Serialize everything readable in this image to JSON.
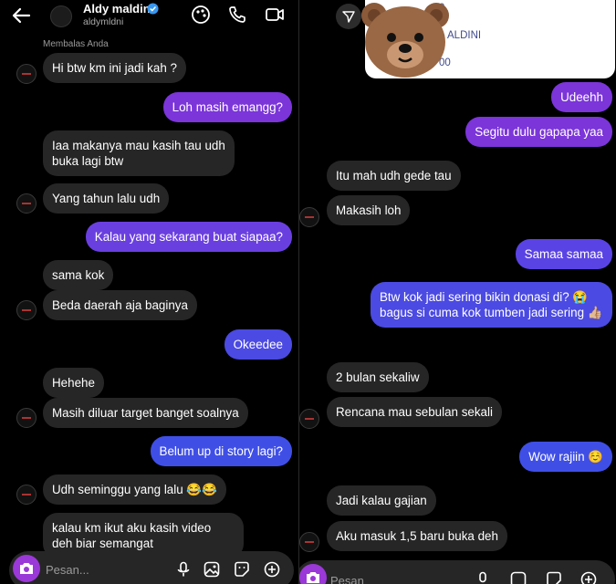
{
  "left_panel": {
    "header": {
      "name": "Aldy maldini",
      "username": "aldymldni"
    },
    "reply_note": "Membalas Anda",
    "messages": [
      {
        "text": "Hi btw km ini jadi kah ?",
        "from": "them"
      },
      {
        "text": "Loh masih emangg?",
        "from": "me"
      },
      {
        "text": "Iaa makanya mau kasih tau udh buka lagi btw",
        "from": "them"
      },
      {
        "text": "Yang tahun lalu udh",
        "from": "them"
      },
      {
        "text": "Kalau yang sekarang buat siapaa?",
        "from": "me"
      },
      {
        "text": "sama kok",
        "from": "them"
      },
      {
        "text": "Beda daerah aja baginya",
        "from": "them"
      },
      {
        "text": "Okeedee",
        "from": "me"
      },
      {
        "text": "Hehehe",
        "from": "them"
      },
      {
        "text": "Masih diluar target banget soalnya",
        "from": "them"
      },
      {
        "text": "Belum up di story lagi?",
        "from": "me"
      },
      {
        "text": "Udh seminggu yang lalu 😂😂",
        "from": "them"
      },
      {
        "text": "kalau km ikut aku kasih video deh biar semangat",
        "from": "them"
      }
    ],
    "composer": {
      "placeholder": "Pesan..."
    }
  },
  "right_panel": {
    "shared_card": {
      "line1": "0",
      "line2": "ALDINI",
      "line3": "00"
    },
    "messages": [
      {
        "text": "Udeehh",
        "from": "me"
      },
      {
        "text": "Segitu dulu gapapa yaa",
        "from": "me"
      },
      {
        "text": "Itu mah udh gede tau",
        "from": "them"
      },
      {
        "text": "Makasih loh",
        "from": "them"
      },
      {
        "text": "Samaa samaa",
        "from": "me"
      },
      {
        "text": "Btw kok jadi sering bikin donasi di? 😭 bagus si cuma kok tumben jadi sering 👍🏼",
        "from": "me"
      },
      {
        "text": "2 bulan sekaliw",
        "from": "them"
      },
      {
        "text": "Rencana mau sebulan sekali",
        "from": "them"
      },
      {
        "text": "Wow rajiin ☺️",
        "from": "me"
      },
      {
        "text": "Jadi kalau gajian",
        "from": "them"
      },
      {
        "text": "Aku masuk 1,5 baru buka deh",
        "from": "them"
      }
    ],
    "composer": {
      "placeholder": "Pesan"
    }
  },
  "colors": {
    "outgoing_purple": "#7b35d9",
    "outgoing_blue": "#3f4fe6",
    "incoming": "#262626",
    "background": "#000000"
  }
}
